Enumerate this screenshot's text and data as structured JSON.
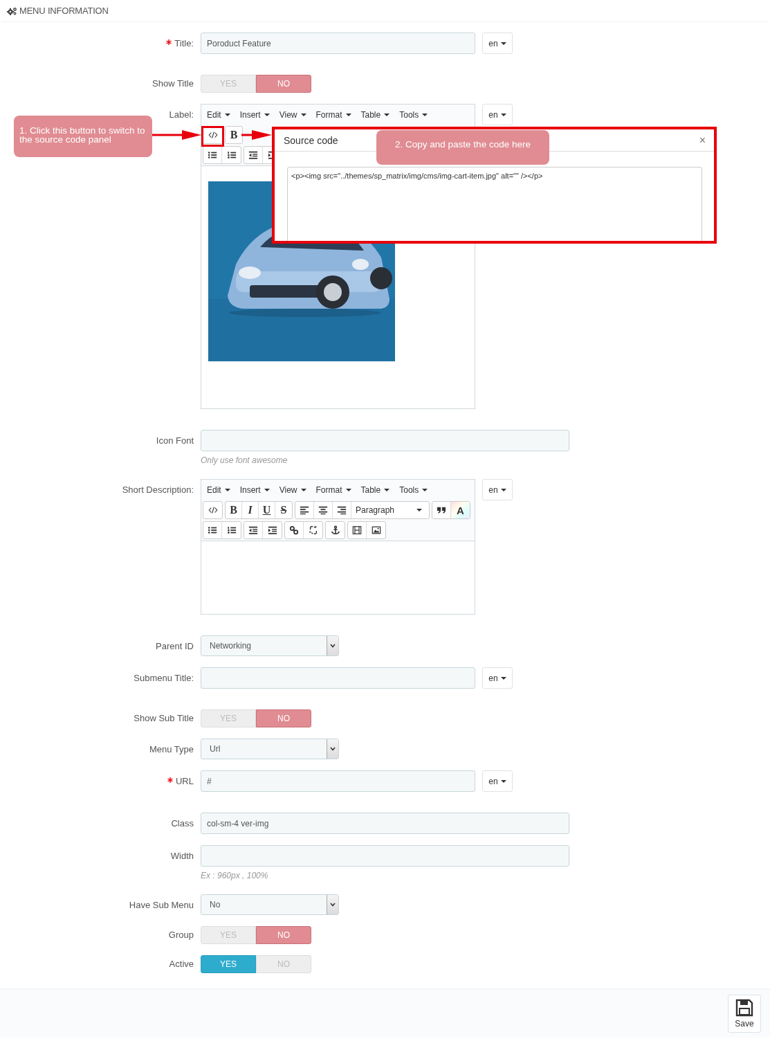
{
  "header": {
    "title": "MENU INFORMATION"
  },
  "fields": [
    {
      "kind": "text",
      "label": "Title:",
      "required": true,
      "wide": false,
      "value": "Poroduct Feature",
      "lang": "en"
    },
    {
      "kind": "toggle",
      "label": "Show Title",
      "required": false,
      "options": [
        {
          "label": "YES",
          "selected": false
        },
        {
          "label": "NO",
          "selected": true
        }
      ]
    },
    {
      "kind": "editor",
      "label": "Label:",
      "required": false,
      "lang": "en",
      "menu": [
        "Edit",
        "Insert",
        "View",
        "Format",
        "Table",
        "Tools"
      ],
      "style_buttons": [
        "B"
      ],
      "content": {
        "kind": "picture"
      },
      "source_dialog": {
        "title": "Source code",
        "close": "×",
        "code": "<p><img src=\"../themes/sp_matrix/img/cms/img-cart-item.jpg\" alt=\"\" /></p>"
      }
    },
    {
      "kind": "text",
      "label": "Icon Font",
      "required": false,
      "wide": true,
      "help": "Only use font awesome"
    },
    {
      "kind": "editor",
      "label": "Short Description:",
      "required": false,
      "lang": "en",
      "menu": [
        "Edit",
        "Insert",
        "View",
        "Format",
        "Table",
        "Tools"
      ],
      "style_buttons": [
        "B",
        "I",
        "U",
        "S"
      ],
      "format": "Paragraph",
      "color_button": "A"
    },
    {
      "kind": "select",
      "label": "Parent ID",
      "required": false,
      "value": "Networking"
    },
    {
      "kind": "text",
      "label": "Submenu Title:",
      "required": false,
      "wide": false,
      "lang": "en"
    },
    {
      "kind": "toggle",
      "label": "Show Sub Title",
      "required": false,
      "options": [
        {
          "label": "YES",
          "selected": false
        },
        {
          "label": "NO",
          "selected": true
        }
      ]
    },
    {
      "kind": "select",
      "label": "Menu Type",
      "required": false,
      "value": "Url"
    },
    {
      "kind": "text",
      "label": "URL",
      "required": true,
      "wide": false,
      "value": "#",
      "lang": "en"
    },
    {
      "kind": "text",
      "label": "Class",
      "required": false,
      "wide": true,
      "value": "col-sm-4 ver-img"
    },
    {
      "kind": "text",
      "label": "Width",
      "required": false,
      "wide": true,
      "help": "Ex : 960px , 100%"
    },
    {
      "kind": "select",
      "label": "Have Sub Menu",
      "required": false,
      "value": "No"
    },
    {
      "kind": "toggle",
      "label": "Group",
      "required": false,
      "options": [
        {
          "label": "YES",
          "selected": false
        },
        {
          "label": "NO",
          "selected": true
        }
      ]
    },
    {
      "kind": "toggle",
      "label": "Active",
      "required": false,
      "options": [
        {
          "label": "YES",
          "selected": true
        },
        {
          "label": "NO",
          "selected": false
        }
      ]
    }
  ],
  "annotations": [
    {
      "text": "1. Click this button to switch to the source code panel"
    },
    {
      "text": "2. Copy and paste the code here"
    }
  ],
  "footer": {
    "save": "Save"
  }
}
